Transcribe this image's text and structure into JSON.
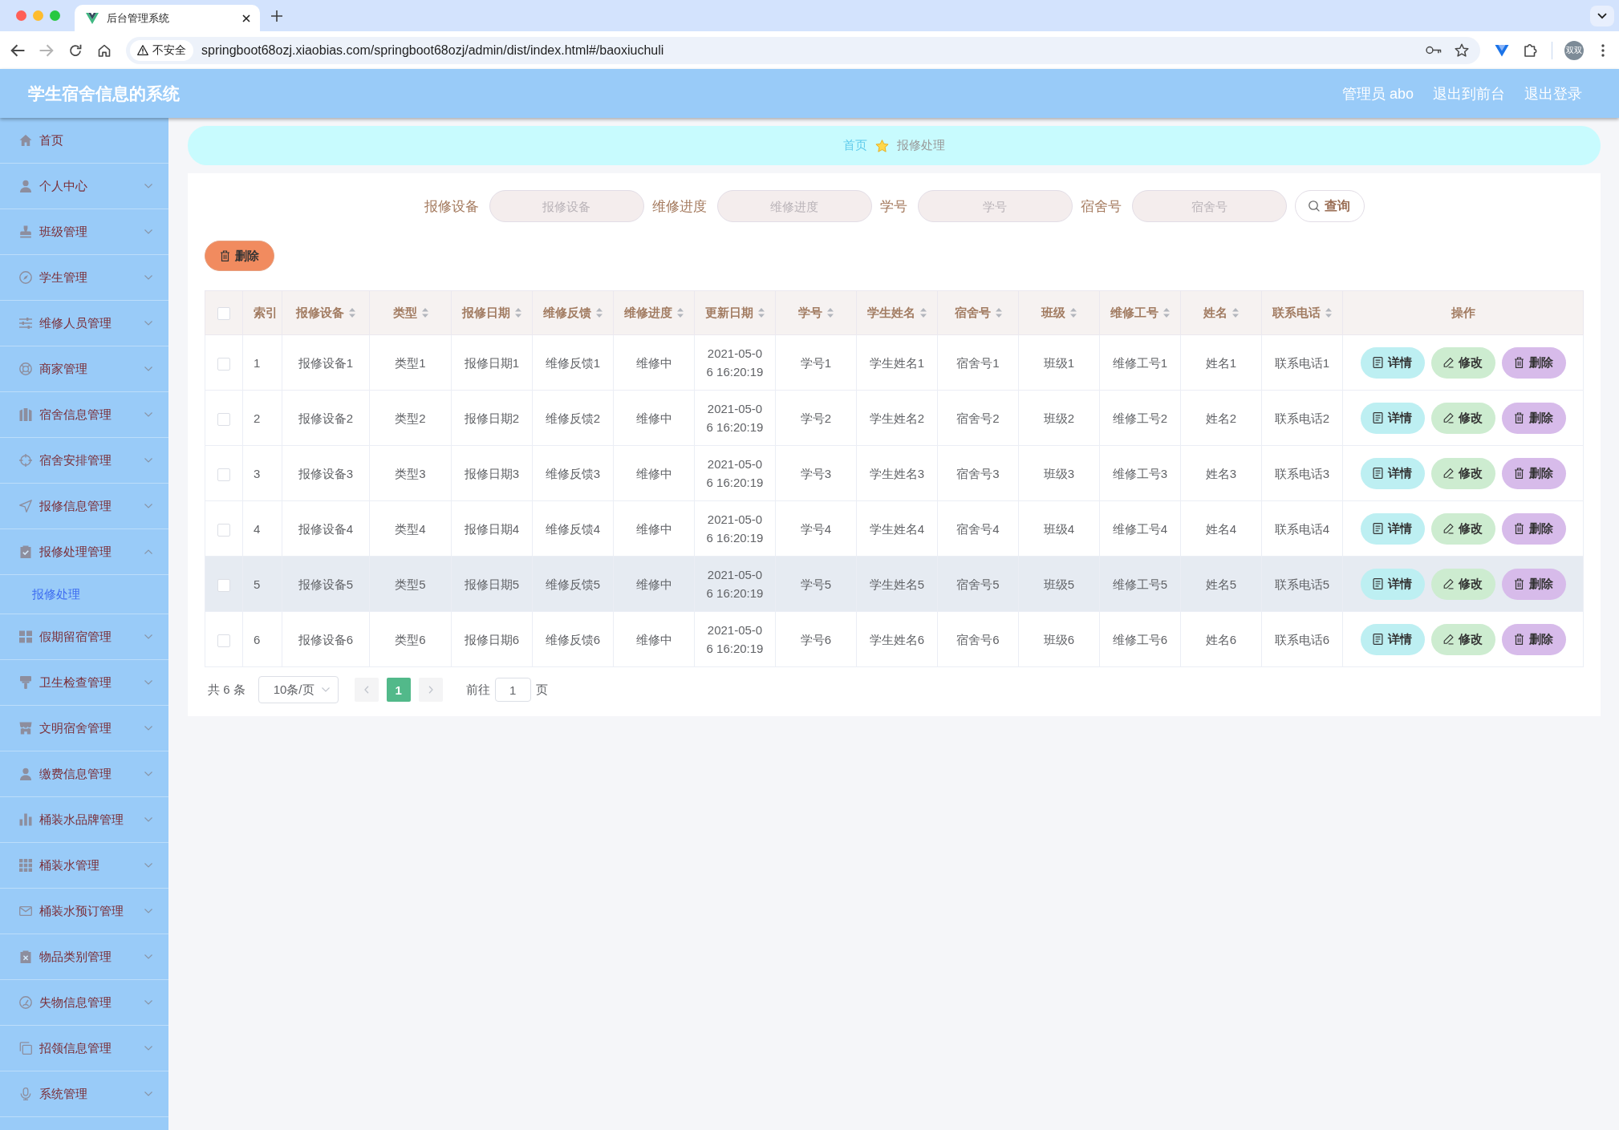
{
  "browser": {
    "tab": {
      "title": "后台管理系统"
    },
    "forward_disabled": true,
    "security_label": "不安全",
    "url": "springboot68ozj.xiaobias.com/springboot68ozj/admin/dist/index.html#/baoxiuchuli",
    "profile": "双双"
  },
  "header": {
    "title": "学生宿舍信息的系统",
    "user": "管理员 abo",
    "links": [
      "退出到前台",
      "退出登录"
    ]
  },
  "sidebar": {
    "items": [
      {
        "label": "首页",
        "kind": "link"
      },
      {
        "label": "个人中心",
        "kind": "submenu",
        "expanded": false
      },
      {
        "label": "班级管理",
        "kind": "submenu",
        "expanded": false
      },
      {
        "label": "学生管理",
        "kind": "submenu",
        "expanded": false
      },
      {
        "label": "维修人员管理",
        "kind": "submenu",
        "expanded": false
      },
      {
        "label": "商家管理",
        "kind": "submenu",
        "expanded": false
      },
      {
        "label": "宿舍信息管理",
        "kind": "submenu",
        "expanded": false
      },
      {
        "label": "宿舍安排管理",
        "kind": "submenu",
        "expanded": false
      },
      {
        "label": "报修信息管理",
        "kind": "submenu",
        "expanded": false
      },
      {
        "label": "报修处理管理",
        "kind": "submenu",
        "expanded": true,
        "children": [
          {
            "label": "报修处理",
            "selected": true
          }
        ]
      },
      {
        "label": "假期留宿管理",
        "kind": "submenu",
        "expanded": false
      },
      {
        "label": "卫生检查管理",
        "kind": "submenu",
        "expanded": false
      },
      {
        "label": "文明宿舍管理",
        "kind": "submenu",
        "expanded": false
      },
      {
        "label": "缴费信息管理",
        "kind": "submenu",
        "expanded": false
      },
      {
        "label": "桶装水品牌管理",
        "kind": "submenu",
        "expanded": false
      },
      {
        "label": "桶装水管理",
        "kind": "submenu",
        "expanded": false
      },
      {
        "label": "桶装水预订管理",
        "kind": "submenu",
        "expanded": false
      },
      {
        "label": "物品类别管理",
        "kind": "submenu",
        "expanded": false
      },
      {
        "label": "失物信息管理",
        "kind": "submenu",
        "expanded": false
      },
      {
        "label": "招领信息管理",
        "kind": "submenu",
        "expanded": false
      },
      {
        "label": "系统管理",
        "kind": "submenu",
        "expanded": false
      }
    ]
  },
  "breadcrumb": [
    {
      "label": "首页",
      "current": false
    },
    {
      "label": "报修处理",
      "current": true
    }
  ],
  "search": {
    "fields": [
      {
        "label": "报修设备",
        "placeholder": "报修设备"
      },
      {
        "label": "维修进度",
        "placeholder": "维修进度"
      },
      {
        "label": "学号",
        "placeholder": "学号"
      },
      {
        "label": "宿舍号",
        "placeholder": "宿舍号"
      }
    ],
    "button": "查询"
  },
  "toolbar": {
    "delete_button": "删除"
  },
  "table": {
    "select_all_checked": false,
    "columns": [
      {
        "label": "索引",
        "sortable": false
      },
      {
        "label": "报修设备",
        "sortable": true
      },
      {
        "label": "类型",
        "sortable": true
      },
      {
        "label": "报修日期",
        "sortable": true
      },
      {
        "label": "维修反馈",
        "sortable": true
      },
      {
        "label": "维修进度",
        "sortable": true
      },
      {
        "label": "更新日期",
        "sortable": true
      },
      {
        "label": "学号",
        "sortable": true
      },
      {
        "label": "学生姓名",
        "sortable": true
      },
      {
        "label": "宿舍号",
        "sortable": true
      },
      {
        "label": "班级",
        "sortable": true
      },
      {
        "label": "维修工号",
        "sortable": true
      },
      {
        "label": "姓名",
        "sortable": true
      },
      {
        "label": "联系电话",
        "sortable": true
      },
      {
        "label": "操作",
        "sortable": false
      }
    ],
    "rows": [
      {
        "checked": false,
        "highlighted": false,
        "cells": [
          "1",
          "报修设备1",
          "类型1",
          "报修日期1",
          "维修反馈1",
          "维修中",
          "2021-05-06 16:20:19",
          "学号1",
          "学生姓名1",
          "宿舍号1",
          "班级1",
          "维修工号1",
          "姓名1",
          "联系电话1"
        ],
        "actions": [
          {
            "kind": "detail",
            "label": "详情"
          },
          {
            "kind": "edit",
            "label": "修改"
          },
          {
            "kind": "delete",
            "label": "删除"
          }
        ]
      },
      {
        "checked": false,
        "highlighted": false,
        "cells": [
          "2",
          "报修设备2",
          "类型2",
          "报修日期2",
          "维修反馈2",
          "维修中",
          "2021-05-06 16:20:19",
          "学号2",
          "学生姓名2",
          "宿舍号2",
          "班级2",
          "维修工号2",
          "姓名2",
          "联系电话2"
        ],
        "actions": [
          {
            "kind": "detail",
            "label": "详情"
          },
          {
            "kind": "edit",
            "label": "修改"
          },
          {
            "kind": "delete",
            "label": "删除"
          }
        ]
      },
      {
        "checked": false,
        "highlighted": false,
        "cells": [
          "3",
          "报修设备3",
          "类型3",
          "报修日期3",
          "维修反馈3",
          "维修中",
          "2021-05-06 16:20:19",
          "学号3",
          "学生姓名3",
          "宿舍号3",
          "班级3",
          "维修工号3",
          "姓名3",
          "联系电话3"
        ],
        "actions": [
          {
            "kind": "detail",
            "label": "详情"
          },
          {
            "kind": "edit",
            "label": "修改"
          },
          {
            "kind": "delete",
            "label": "删除"
          }
        ]
      },
      {
        "checked": false,
        "highlighted": false,
        "cells": [
          "4",
          "报修设备4",
          "类型4",
          "报修日期4",
          "维修反馈4",
          "维修中",
          "2021-05-06 16:20:19",
          "学号4",
          "学生姓名4",
          "宿舍号4",
          "班级4",
          "维修工号4",
          "姓名4",
          "联系电话4"
        ],
        "actions": [
          {
            "kind": "detail",
            "label": "详情"
          },
          {
            "kind": "edit",
            "label": "修改"
          },
          {
            "kind": "delete",
            "label": "删除"
          }
        ]
      },
      {
        "checked": false,
        "highlighted": true,
        "cells": [
          "5",
          "报修设备5",
          "类型5",
          "报修日期5",
          "维修反馈5",
          "维修中",
          "2021-05-06 16:20:19",
          "学号5",
          "学生姓名5",
          "宿舍号5",
          "班级5",
          "维修工号5",
          "姓名5",
          "联系电话5"
        ],
        "actions": [
          {
            "kind": "detail",
            "label": "详情"
          },
          {
            "kind": "edit",
            "label": "修改"
          },
          {
            "kind": "delete",
            "label": "删除"
          }
        ]
      },
      {
        "checked": false,
        "highlighted": false,
        "cells": [
          "6",
          "报修设备6",
          "类型6",
          "报修日期6",
          "维修反馈6",
          "维修中",
          "2021-05-06 16:20:19",
          "学号6",
          "学生姓名6",
          "宿舍号6",
          "班级6",
          "维修工号6",
          "姓名6",
          "联系电话6"
        ],
        "actions": [
          {
            "kind": "detail",
            "label": "详情"
          },
          {
            "kind": "edit",
            "label": "修改"
          },
          {
            "kind": "delete",
            "label": "删除"
          }
        ]
      }
    ]
  },
  "pagination": {
    "total": "共 6 条",
    "page_size": "10条/页",
    "prev_disabled": true,
    "pages": [
      {
        "label": "1",
        "selected": true
      }
    ],
    "next_disabled": true,
    "goto_label": "前往",
    "goto_value": "1",
    "goto_suffix": "页"
  }
}
